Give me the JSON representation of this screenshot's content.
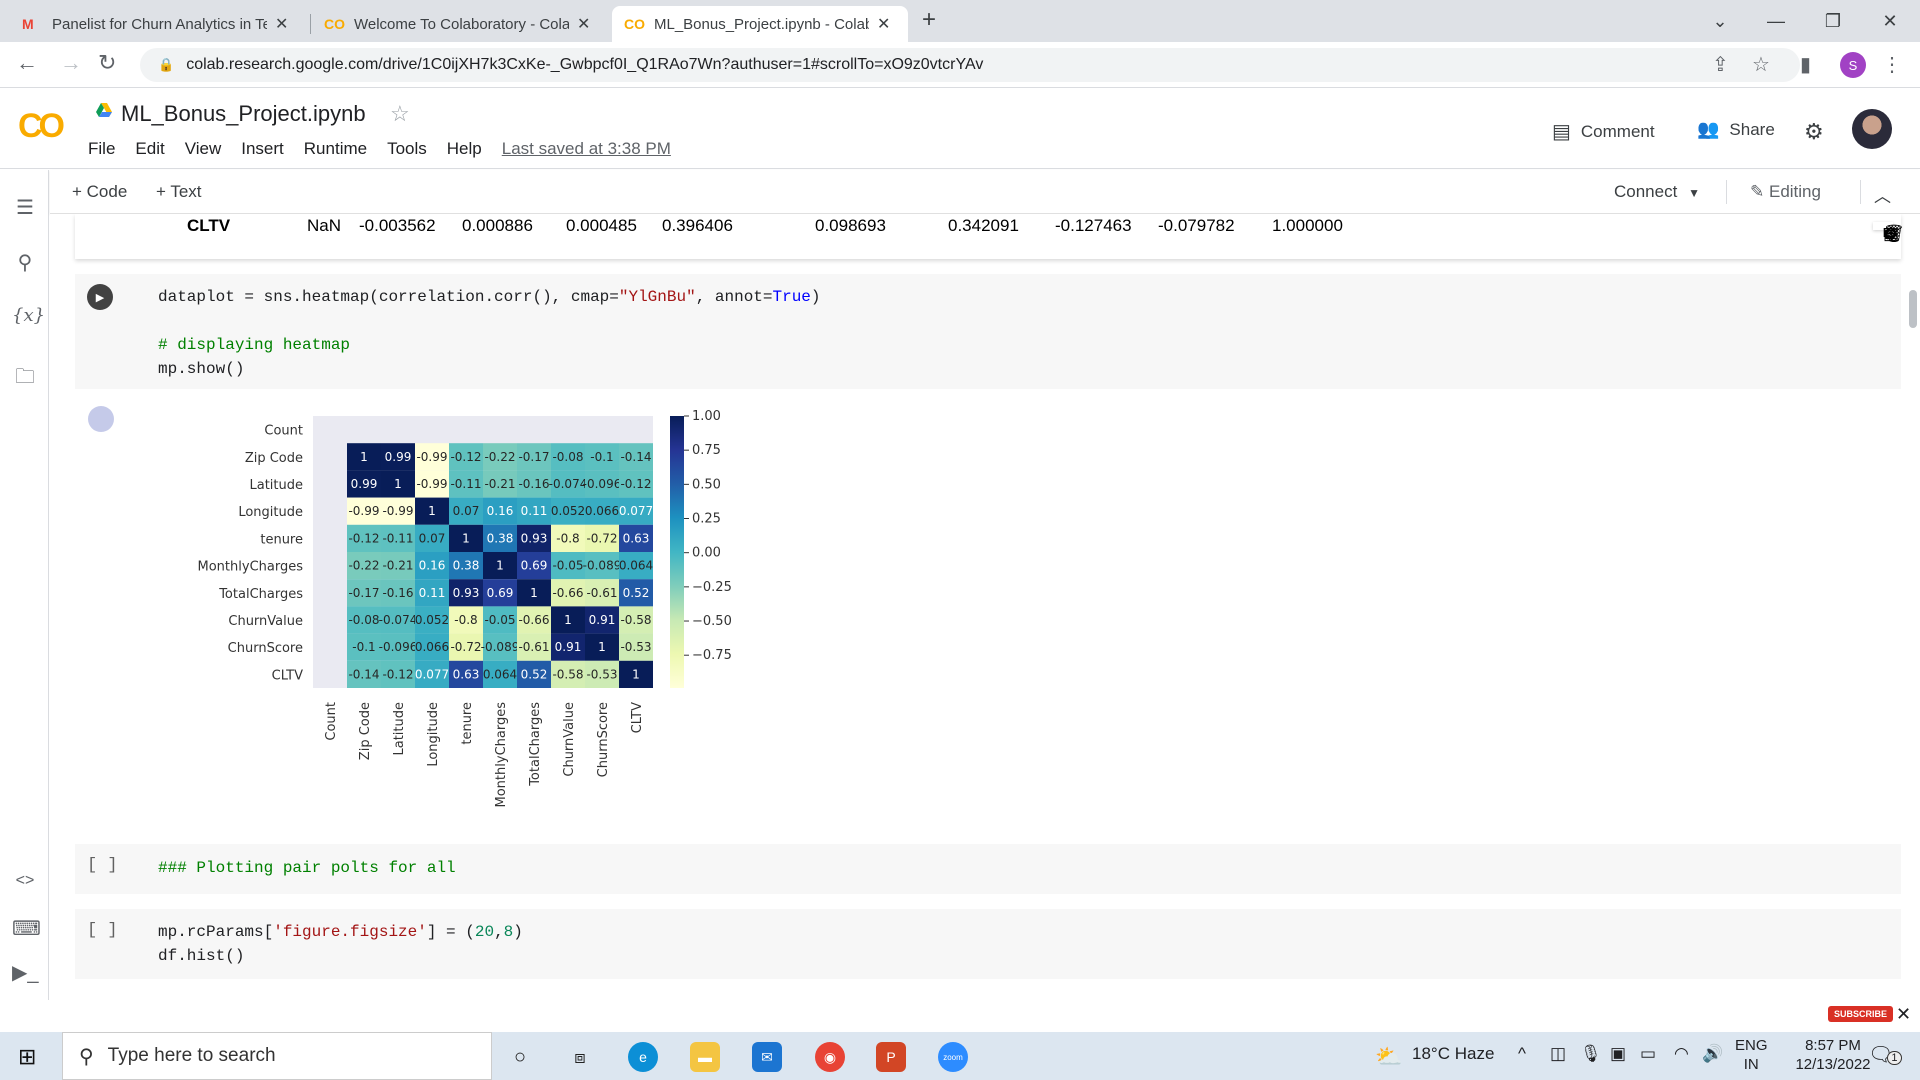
{
  "browser": {
    "tabs": [
      {
        "label": "Panelist for Churn Analytics in Te",
        "icon": "gmail-icon",
        "active": false
      },
      {
        "label": "Welcome To Colaboratory - Cola",
        "icon": "colab-icon",
        "active": false
      },
      {
        "label": "ML_Bonus_Project.ipynb - Colab",
        "icon": "colab-icon",
        "active": true
      }
    ],
    "url": "colab.research.google.com/drive/1C0ijXH7k3CxKe-_Gwbpcf0I_Q1RAo7Wn?authuser=1#scrollTo=xO9z0vtcrYAv",
    "profile_initial": "S"
  },
  "colab": {
    "notebook_title": "ML_Bonus_Project.ipynb",
    "menu": [
      "File",
      "Edit",
      "View",
      "Insert",
      "Runtime",
      "Tools",
      "Help"
    ],
    "last_saved": "Last saved at 3:38 PM",
    "comment_label": "Comment",
    "share_label": "Share",
    "add_code_label": "+ Code",
    "add_text_label": "+ Text",
    "connect_label": "Connect",
    "editing_label": "Editing"
  },
  "output_row": {
    "label": "CLTV",
    "values": [
      "NaN",
      "-0.003562",
      "0.000886",
      "0.000485",
      "0.396406",
      "0.098693",
      "0.342091",
      "-0.127463",
      "-0.079782",
      "1.000000"
    ]
  },
  "cells": {
    "heatmap_cell": {
      "line1_a": "dataplot = sns.heatmap(correlation.corr(), cmap=",
      "line1_str": "\"YlGnBu\"",
      "line1_b": ", annot=",
      "line1_kw": "True",
      "line1_c": ")",
      "line3": "# displaying heatmap",
      "line4": "mp.show()"
    },
    "markdown_cell": {
      "bracket": "[ ]",
      "text": "### Plotting pair polts for all"
    },
    "hist_cell": {
      "bracket": "[ ]",
      "line1_a": "mp.rcParams[",
      "line1_str": "'figure.figsize'",
      "line1_b": "] = (",
      "line1_n1": "20",
      "line1_c": ",",
      "line1_n2": "8",
      "line1_d": ")",
      "line2": "df.hist()"
    }
  },
  "chart_data": {
    "type": "heatmap",
    "title": "",
    "colormap": "YlGnBu",
    "row_labels": [
      "Count",
      "Zip Code",
      "Latitude",
      "Longitude",
      "tenure",
      "MonthlyCharges",
      "TotalCharges",
      "ChurnValue",
      "ChurnScore",
      "CLTV"
    ],
    "col_labels": [
      "Count",
      "Zip Code",
      "Latitude",
      "Longitude",
      "tenure",
      "MonthlyCharges",
      "TotalCharges",
      "ChurnValue",
      "ChurnScore",
      "CLTV"
    ],
    "values": [
      [
        null,
        null,
        null,
        null,
        null,
        null,
        null,
        null,
        null,
        null
      ],
      [
        null,
        1,
        0.99,
        -0.99,
        -0.12,
        -0.22,
        -0.17,
        -0.08,
        -0.1,
        -0.14
      ],
      [
        null,
        0.99,
        1,
        -0.99,
        -0.11,
        -0.21,
        -0.16,
        -0.074,
        -0.096,
        -0.12
      ],
      [
        null,
        -0.99,
        -0.99,
        1,
        0.07,
        0.16,
        0.11,
        0.052,
        0.066,
        0.077
      ],
      [
        null,
        -0.12,
        -0.11,
        0.07,
        1,
        0.38,
        0.93,
        -0.8,
        -0.72,
        0.63
      ],
      [
        null,
        -0.22,
        -0.21,
        0.16,
        0.38,
        1,
        0.69,
        -0.05,
        -0.089,
        0.064
      ],
      [
        null,
        -0.17,
        -0.16,
        0.11,
        0.93,
        0.69,
        1,
        -0.66,
        -0.61,
        0.52
      ],
      [
        null,
        -0.08,
        -0.074,
        0.052,
        -0.8,
        -0.05,
        -0.66,
        1,
        0.91,
        -0.58
      ],
      [
        null,
        -0.1,
        -0.096,
        0.066,
        -0.72,
        -0.089,
        -0.61,
        0.91,
        1,
        -0.53
      ],
      [
        null,
        -0.14,
        -0.12,
        0.077,
        0.63,
        0.064,
        0.52,
        -0.58,
        -0.53,
        1
      ]
    ],
    "colorbar_ticks": [
      1.0,
      0.75,
      0.5,
      0.25,
      0.0,
      -0.25,
      -0.5,
      -0.75
    ],
    "colorbar_tick_labels": [
      "1.00",
      "0.75",
      "0.50",
      "0.25",
      "0.00",
      "−0.25",
      "−0.50",
      "−0.75"
    ],
    "vmin": -0.99,
    "vmax": 1.0,
    "annot": true
  },
  "taskbar": {
    "search_placeholder": "Type here to search",
    "weather": "18°C  Haze",
    "lang_top": "ENG",
    "lang_bottom": "IN",
    "time": "8:57 PM",
    "date": "12/13/2022",
    "notification_count": "1",
    "subscribe_label": "SUBSCRIBE"
  }
}
